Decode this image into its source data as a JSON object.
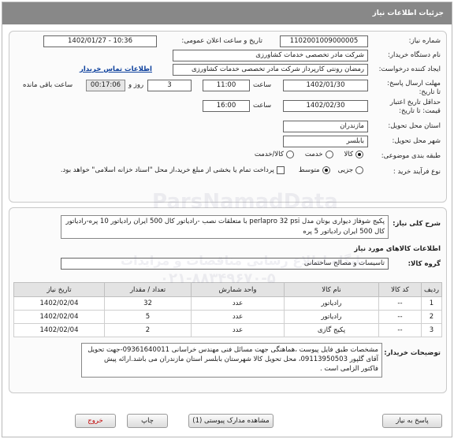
{
  "header": {
    "title": "جزئیات اطلاعات نیاز"
  },
  "form": {
    "need_number": {
      "label": "شماره نیاز:",
      "value": "1102001009000005"
    },
    "announce": {
      "label": "تاریخ و ساعت اعلان عمومی:",
      "value": "1402/01/27 - 10:36"
    },
    "buyer_org": {
      "label": "نام دستگاه خریدار:",
      "value": "شرکت مادر تخصصی خدمات کشاورزی"
    },
    "creator": {
      "label": "ایجاد کننده درخواست:",
      "value": "رمضان رونتی کارپرداز شرکت مادر تخصصی خدمات کشاورزی",
      "contact_link": "اطلاعات تماس خریدار"
    },
    "deadline": {
      "label": "مهلت ارسال پاسخ: تا تاریخ:",
      "date": "1402/01/30",
      "time_label": "ساعت",
      "time": "11:00",
      "days": "3",
      "days_label": "روز و",
      "remaining": "00:17:06",
      "remaining_label": "ساعت باقی مانده"
    },
    "validity": {
      "label": "حداقل تاریخ اعتبار قیمت: تا تاریخ:",
      "date": "1402/02/30",
      "time_label": "ساعت",
      "time": "16:00"
    },
    "province": {
      "label": "استان محل تحویل:",
      "value": "مازندران"
    },
    "city": {
      "label": "شهر محل تحویل:",
      "value": "بابلسر"
    },
    "category": {
      "label": "طبقه بندی موضوعی:",
      "options": [
        "کالا",
        "خدمت",
        "کالا/خدمت"
      ],
      "selected": "کالا"
    },
    "process": {
      "label": "نوع فرآیند خرید :",
      "options": [
        "جزیی",
        "متوسط"
      ],
      "selected": "متوسط",
      "note": "پرداخت تمام یا بخشی از مبلغ خرید،از محل \"اسناد خزانه اسلامی\" خواهد بود."
    }
  },
  "need": {
    "label": "شرح کلی نیاز:",
    "text": "پکیج شوفاژ دیواری بوتان مدل perlapro 32 psi با متعلقات نصب -رادیاتور کال 500 ایران رادیاتور 10 پره-رادیاتور کال 500 ایران رادیاتور 5 پره"
  },
  "goods": {
    "section_title": "اطلاعات کالاهای مورد نیاز",
    "group_label": "گروه کالا:",
    "group_value": "تاسیسات و مصالح ساختمانی",
    "columns": [
      "ردیف",
      "کد کالا",
      "نام کالا",
      "واحد شمارش",
      "تعداد / مقدار",
      "تاریخ نیاز"
    ],
    "rows": [
      [
        "1",
        "--",
        "رادیاتور",
        "عدد",
        "32",
        "1402/02/04"
      ],
      [
        "2",
        "--",
        "رادیاتور",
        "عدد",
        "5",
        "1402/02/04"
      ],
      [
        "3",
        "--",
        "پکیج گازی",
        "عدد",
        "2",
        "1402/02/04"
      ]
    ]
  },
  "buyer_notes": {
    "label": "توضیحات خریدار:",
    "text": "مشخصات طبق فایل پیوست ،هماهنگی جهت مسائل فنی مهندس خراسانی 09361640011-جهت تحویل آقای گلپور 09113950503، محل تحویل کالا شهرستان بابلسر استان مازندران می باشد.ارائه پیش فاکتور الزامی است ."
  },
  "buttons": {
    "reply": "پاسخ به نیاز",
    "attachments": "مشاهده مدارک پیوستی (1)",
    "print": "چاپ",
    "exit": "خروج"
  },
  "watermark": {
    "brand": "ParsNamadData",
    "site": "پایگاه اطلاع رسانی مناقصات و مزایدات",
    "phone": "۰۲۱-۸۸۳۴۹۶۷۰-۵"
  },
  "colors": {
    "title_bar": "#888888",
    "link": "#0b3f9c",
    "exit_text": "#c00000"
  }
}
